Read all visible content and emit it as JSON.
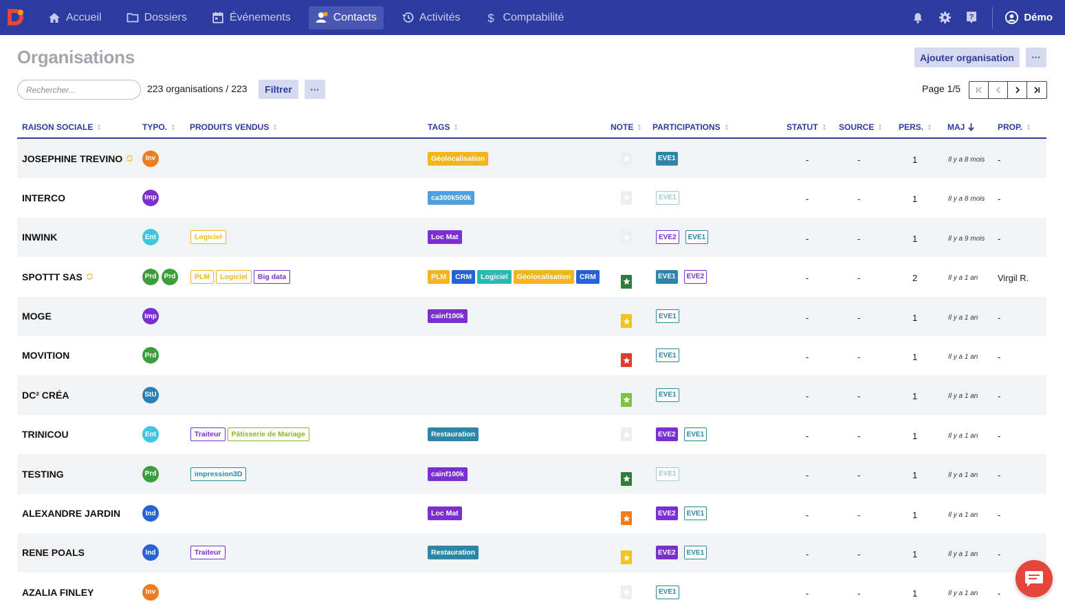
{
  "nav": {
    "items": [
      {
        "label": "Accueil",
        "icon": "home-icon",
        "active": false
      },
      {
        "label": "Dossiers",
        "icon": "folder-icon",
        "active": false
      },
      {
        "label": "Événements",
        "icon": "calendar-icon",
        "active": false
      },
      {
        "label": "Contacts",
        "icon": "user-icon",
        "active": true
      },
      {
        "label": "Activités",
        "icon": "history-icon",
        "active": false
      },
      {
        "label": "Comptabilité",
        "icon": "dollar-icon",
        "active": false
      }
    ],
    "user": "Démo"
  },
  "header": {
    "title": "Organisations",
    "add_label": "Ajouter organisation",
    "more_label": "···"
  },
  "toolbar": {
    "search_placeholder": "Rechercher...",
    "count": "223 organisations / 223",
    "filter_label": "Filtrer",
    "more_label": "···",
    "page_label": "Page 1/5"
  },
  "columns": [
    {
      "key": "name",
      "label": "RAISON SOCIALE",
      "sort": "both"
    },
    {
      "key": "typo",
      "label": "TYPO.",
      "sort": "both"
    },
    {
      "key": "produits",
      "label": "PRODUITS VENDUS",
      "sort": "both"
    },
    {
      "key": "tags",
      "label": "TAGS",
      "sort": "both"
    },
    {
      "key": "note",
      "label": "NOTE",
      "sort": "both"
    },
    {
      "key": "participations",
      "label": "PARTICIPATIONS",
      "sort": "both"
    },
    {
      "key": "statut",
      "label": "STATUT",
      "sort": "both"
    },
    {
      "key": "source",
      "label": "SOURCE",
      "sort": "both"
    },
    {
      "key": "pers",
      "label": "PERS.",
      "sort": "both"
    },
    {
      "key": "maj",
      "label": "MAJ",
      "sort": "desc"
    },
    {
      "key": "prop",
      "label": "PROP.",
      "sort": "both"
    }
  ],
  "colors": {
    "Inv": "#ef7d1e",
    "Imp": "#7b2fd0",
    "Ent": "#3ec6e0",
    "Prd": "#3a9e3a",
    "StU": "#2b7fb8",
    "Ind": "#2563d6",
    "nav_bg": "#2d3a9e",
    "accent": "#2d3a9e"
  },
  "rows": [
    {
      "name": "JOSEPHINE TREVINO",
      "sync": true,
      "typo": [
        "Inv"
      ],
      "produits": [],
      "tags": [
        {
          "t": "Géolocalisation",
          "c": "#f2b51f"
        }
      ],
      "note": "empty",
      "parts": [
        {
          "t": "EVE1",
          "s": "fill",
          "c": "#2d86a8"
        }
      ],
      "statut": "-",
      "source": "-",
      "pers": "1",
      "maj": "Il y a 8 mois",
      "prop": "-"
    },
    {
      "name": "INTERCO",
      "sync": false,
      "typo": [
        "Imp"
      ],
      "produits": [],
      "tags": [
        {
          "t": "ca300k500k",
          "c": "#4aa0e0"
        }
      ],
      "note": "empty",
      "parts": [
        {
          "t": "EVE1",
          "s": "faded",
          "c": "#9ccbd8"
        }
      ],
      "statut": "-",
      "source": "-",
      "pers": "1",
      "maj": "Il y a 8 mois",
      "prop": "-"
    },
    {
      "name": "INWINK",
      "sync": false,
      "typo": [
        "Ent"
      ],
      "produits": [
        {
          "t": "Logiciel",
          "c": "#f2b51f"
        }
      ],
      "tags": [
        {
          "t": "Loc Mat",
          "c": "#7b2fd0"
        }
      ],
      "note": "empty",
      "parts": [
        {
          "t": "EVE2",
          "s": "out",
          "c": "#7b2fd0"
        },
        {
          "t": "EVE1",
          "s": "out",
          "c": "#2d86a8"
        }
      ],
      "statut": "-",
      "source": "-",
      "pers": "1",
      "maj": "Il y a 9 mois",
      "prop": "-"
    },
    {
      "name": "SPOTTT SAS",
      "sync": true,
      "typo": [
        "Prd",
        "Prd"
      ],
      "produits": [
        {
          "t": "PLM",
          "c": "#f2b51f"
        },
        {
          "t": "Logiciel",
          "c": "#f2b51f"
        },
        {
          "t": "Big data",
          "c": "#7b2fd0"
        }
      ],
      "tags": [
        {
          "t": "PLM",
          "c": "#f2b51f"
        },
        {
          "t": "CRM",
          "c": "#2563d6"
        },
        {
          "t": "Logiciel",
          "c": "#2bb8b0"
        },
        {
          "t": "Géolocalisation",
          "c": "#f2b51f"
        },
        {
          "t": "CRM",
          "c": "#2563d6"
        }
      ],
      "note": "#2e7d3a",
      "parts": [
        {
          "t": "EVE1",
          "s": "fill",
          "c": "#2d86a8"
        },
        {
          "t": "EVE2",
          "s": "out",
          "c": "#7b2fd0"
        }
      ],
      "statut": "-",
      "source": "-",
      "pers": "2",
      "maj": "Il y a 1 an",
      "prop": "Virgil R."
    },
    {
      "name": "MOGE",
      "sync": false,
      "typo": [
        "Imp"
      ],
      "produits": [],
      "tags": [
        {
          "t": "cainf100k",
          "c": "#7b2fd0"
        }
      ],
      "note": "#f2c21f",
      "parts": [
        {
          "t": "EVE1",
          "s": "out",
          "c": "#2d86a8"
        }
      ],
      "statut": "-",
      "source": "-",
      "pers": "1",
      "maj": "Il y a 1 an",
      "prop": "-"
    },
    {
      "name": "MOVITION",
      "sync": false,
      "typo": [
        "Prd"
      ],
      "produits": [],
      "tags": [],
      "note": "#e03a2a",
      "parts": [
        {
          "t": "EVE1",
          "s": "out",
          "c": "#2d86a8"
        }
      ],
      "statut": "-",
      "source": "-",
      "pers": "1",
      "maj": "Il y a 1 an",
      "prop": "-"
    },
    {
      "name": "DC² CRÉA",
      "sync": false,
      "typo": [
        "StU"
      ],
      "produits": [],
      "tags": [],
      "note": "#7cc23a",
      "parts": [
        {
          "t": "EVE1",
          "s": "out",
          "c": "#2d86a8"
        }
      ],
      "statut": "-",
      "source": "-",
      "pers": "1",
      "maj": "Il y a 1 an",
      "prop": "-"
    },
    {
      "name": "TRINICOU",
      "sync": false,
      "typo": [
        "Ent"
      ],
      "produits": [
        {
          "t": "Traiteur",
          "c": "#7b2fd0"
        },
        {
          "t": "Pâtisserie de Mariage",
          "c": "#8ab52a"
        }
      ],
      "tags": [
        {
          "t": "Restauration",
          "c": "#2d86a8"
        }
      ],
      "note": "empty",
      "parts": [
        {
          "t": "EVE2",
          "s": "fill",
          "c": "#7b2fd0"
        },
        {
          "t": "EVE1",
          "s": "out",
          "c": "#2d86a8"
        }
      ],
      "statut": "-",
      "source": "-",
      "pers": "1",
      "maj": "Il y a 1 an",
      "prop": "-"
    },
    {
      "name": "TESTING",
      "sync": false,
      "typo": [
        "Prd"
      ],
      "produits": [
        {
          "t": "impression3D",
          "c": "#2d86a8"
        }
      ],
      "tags": [
        {
          "t": "cainf100k",
          "c": "#7b2fd0"
        }
      ],
      "note": "#2e7d3a",
      "parts": [
        {
          "t": "EVE1",
          "s": "faded",
          "c": "#9ccbd8"
        }
      ],
      "statut": "-",
      "source": "-",
      "pers": "1",
      "maj": "Il y a 1 an",
      "prop": "-"
    },
    {
      "name": "ALEXANDRE JARDIN",
      "sync": false,
      "typo": [
        "Ind"
      ],
      "produits": [],
      "tags": [
        {
          "t": "Loc Mat",
          "c": "#7b2fd0"
        }
      ],
      "note": "#ef7d1e",
      "parts": [
        {
          "t": "EVE2",
          "s": "fill",
          "c": "#7b2fd0"
        },
        {
          "t": "EVE1",
          "s": "out",
          "c": "#2d86a8"
        }
      ],
      "statut": "-",
      "source": "-",
      "pers": "1",
      "maj": "Il y a 1 an",
      "prop": "-"
    },
    {
      "name": "RENE POALS",
      "sync": false,
      "typo": [
        "Ind"
      ],
      "produits": [
        {
          "t": "Traiteur",
          "c": "#7b2fd0"
        }
      ],
      "tags": [
        {
          "t": "Restauration",
          "c": "#2d86a8"
        }
      ],
      "note": "#f2c21f",
      "parts": [
        {
          "t": "EVE2",
          "s": "fill",
          "c": "#7b2fd0"
        },
        {
          "t": "EVE1",
          "s": "out",
          "c": "#2d86a8"
        }
      ],
      "statut": "-",
      "source": "-",
      "pers": "1",
      "maj": "Il y a 1 an",
      "prop": "-"
    },
    {
      "name": "AZALIA FINLEY",
      "sync": false,
      "typo": [
        "Inv"
      ],
      "produits": [],
      "tags": [],
      "note": "empty",
      "parts": [
        {
          "t": "EVE1",
          "s": "out",
          "c": "#2d86a8"
        }
      ],
      "statut": "-",
      "source": "-",
      "pers": "1",
      "maj": "Il y a 1 an",
      "prop": "-"
    }
  ]
}
